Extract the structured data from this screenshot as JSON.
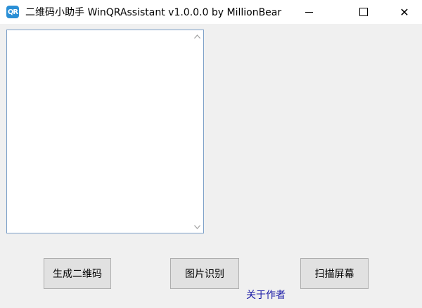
{
  "window": {
    "app_icon_text": "QR",
    "title": "二维码小助手 WinQRAssistant v1.0.0.0   by MillionBear",
    "minimize_label": "",
    "maximize_label": "",
    "close_label": "✕"
  },
  "input": {
    "value": "",
    "placeholder": ""
  },
  "buttons": {
    "generate": "生成二维码",
    "image_recognition": "图片识别",
    "scan_screen": "扫描屏幕"
  },
  "links": {
    "about": "关于作者"
  },
  "colors": {
    "icon_blue": "#2a8fd6",
    "link_blue": "#1a1aa6",
    "textarea_border": "#7a9ec7"
  }
}
